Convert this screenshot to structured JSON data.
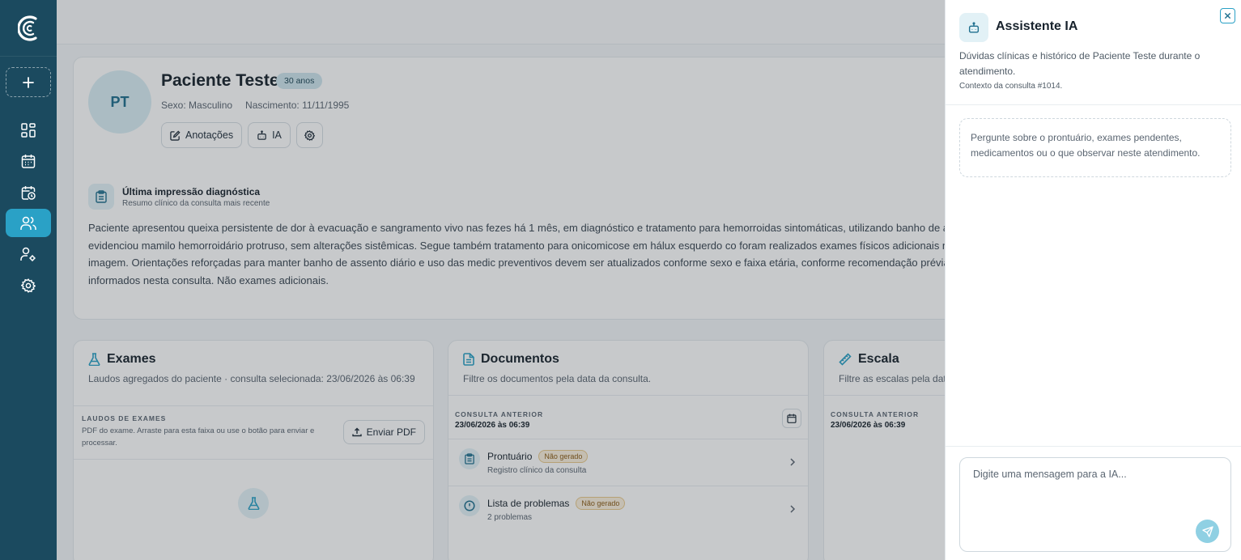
{
  "sidebar": {
    "logo_icon": "brand-c-logo",
    "new_icon": "plus-icon",
    "items": [
      {
        "name": "dashboard",
        "icon": "grid-icon"
      },
      {
        "name": "agenda",
        "icon": "calendar-icon"
      },
      {
        "name": "consultas",
        "icon": "calendar-clock-icon"
      },
      {
        "name": "pacientes",
        "icon": "users-icon",
        "active": true
      },
      {
        "name": "usuarios",
        "icon": "user-cog-icon"
      },
      {
        "name": "configuracoes",
        "icon": "gear-icon"
      }
    ]
  },
  "patient": {
    "initials": "PT",
    "name": "Paciente Teste",
    "age_badge": "30 anos",
    "sex": "Sexo: Masculino",
    "birth": "Nascimento: 11/11/1995",
    "actions": {
      "notes": "Anotações",
      "ai": "IA"
    }
  },
  "diagnosis": {
    "title": "Última impressão diagnóstica",
    "subtitle": "Resumo clínico da consulta mais recente",
    "text": "Paciente apresentou queixa persistente de dor à evacuação e sangramento vivo nas fezes há 1 mês, em diagnóstico e tratamento para hemorroidas sintomáticas, utilizando banho de asse dor ou febre. Exame físico proctológico anterior evidenciou mamilo hemorroidário protruso, sem alterações sistêmicas. Segue também tratamento para onicomicose em hálux esquerdo co foram realizados exames físicos adicionais nesta consulta e não há dados novos laboratoriais ou de imagem. Orientações reforçadas para manter banho de assento diário e uso das medic preventivos devem ser atualizados conforme sexo e faixa etária, conforme recomendação prévia. Avaliação geriátrica ampla e dados de identificação não informados nesta consulta. Não exames adicionais."
  },
  "exams": {
    "title": "Exames",
    "subtitle": "Laudos agregados do paciente · consulta selecionada: 23/06/2026 às 06:39",
    "section_label": "LAUDOS DE EXAMES",
    "section_desc": "PDF do exame. Arraste para esta faixa ou use o botão para enviar e processar.",
    "upload_button": "Enviar PDF"
  },
  "documents": {
    "title": "Documentos",
    "subtitle": "Filtre os documentos pela data da consulta.",
    "section_label": "CONSULTA ANTERIOR",
    "date": "23/06/2026 às 06:39",
    "items": [
      {
        "title": "Prontuário",
        "badge": "Não gerado",
        "sub": "Registro clínico da consulta"
      },
      {
        "title": "Lista de problemas",
        "badge": "Não gerado",
        "sub": "2 problemas"
      }
    ]
  },
  "scale": {
    "title": "Escala",
    "subtitle": "Filtre as escalas pela dat",
    "section_label": "CONSULTA ANTERIOR",
    "date": "23/06/2026 às 06:39"
  },
  "assistant": {
    "title": "Assistente IA",
    "description": "Dúvidas clínicas e histórico de Paciente Teste durante o atendimento.",
    "context": "Contexto da consulta #1014.",
    "hint": "Pergunte sobre o prontuário, exames pendentes, medicamentos ou o que observar neste atendimento.",
    "input_placeholder": "Digite uma mensagem para a IA..."
  },
  "colors": {
    "sidebar": "#1b4a5f",
    "accent": "#2aa1c6",
    "send_disabled": "#8fd0e3"
  }
}
